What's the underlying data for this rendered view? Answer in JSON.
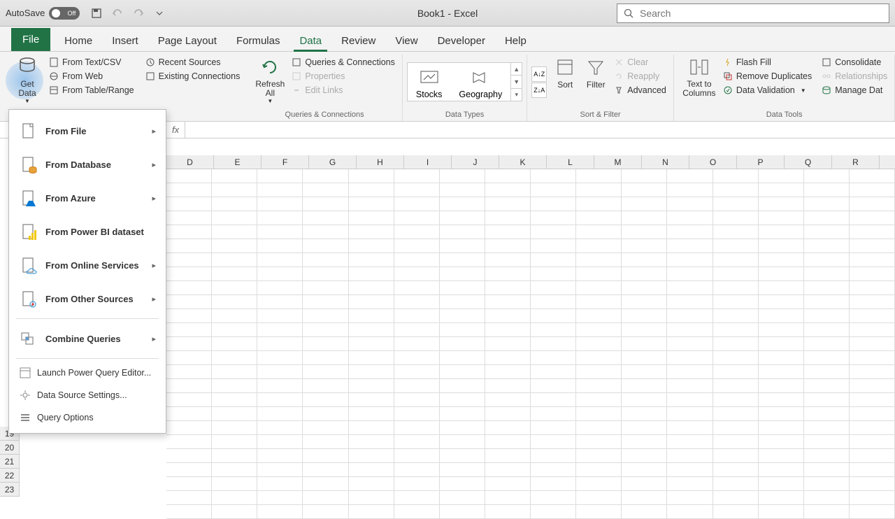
{
  "titlebar": {
    "autosave": "AutoSave",
    "autosave_state": "Off",
    "doc_title": "Book1  -  Excel",
    "search_placeholder": "Search"
  },
  "tabs": {
    "file": "File",
    "home": "Home",
    "insert": "Insert",
    "page_layout": "Page Layout",
    "formulas": "Formulas",
    "data": "Data",
    "review": "Review",
    "view": "View",
    "developer": "Developer",
    "help": "Help"
  },
  "ribbon": {
    "get_data": "Get\nData",
    "from_text": "From Text/CSV",
    "from_web": "From Web",
    "from_table": "From Table/Range",
    "recent_sources": "Recent Sources",
    "existing_conn": "Existing Connections",
    "refresh_all": "Refresh\nAll",
    "queries_conn": "Queries & Connections",
    "properties": "Properties",
    "edit_links": "Edit Links",
    "group_qc": "Queries & Connections",
    "stocks": "Stocks",
    "geography": "Geography",
    "group_dt": "Data Types",
    "sort": "Sort",
    "filter": "Filter",
    "clear": "Clear",
    "reapply": "Reapply",
    "advanced": "Advanced",
    "group_sf": "Sort & Filter",
    "text_to_cols": "Text to\nColumns",
    "flash_fill": "Flash Fill",
    "remove_dup": "Remove Duplicates",
    "data_val": "Data Validation",
    "consolidate": "Consolidate",
    "relationships": "Relationships",
    "manage_data": "Manage Dat",
    "group_tools": "Data Tools"
  },
  "dropdown": {
    "from_file": "From File",
    "from_db": "From Database",
    "from_azure": "From Azure",
    "from_powerbi": "From Power BI dataset",
    "from_online": "From Online Services",
    "from_other": "From Other Sources",
    "combine": "Combine Queries",
    "launch_pq": "Launch Power Query Editor...",
    "ds_settings": "Data Source Settings...",
    "query_opts": "Query Options"
  },
  "columns": [
    "D",
    "E",
    "F",
    "G",
    "H",
    "I",
    "J",
    "K",
    "L",
    "M",
    "N",
    "O",
    "P",
    "Q",
    "R"
  ],
  "rows": [
    "19",
    "20",
    "21",
    "22",
    "23"
  ],
  "formula": {
    "fx": "fx"
  }
}
